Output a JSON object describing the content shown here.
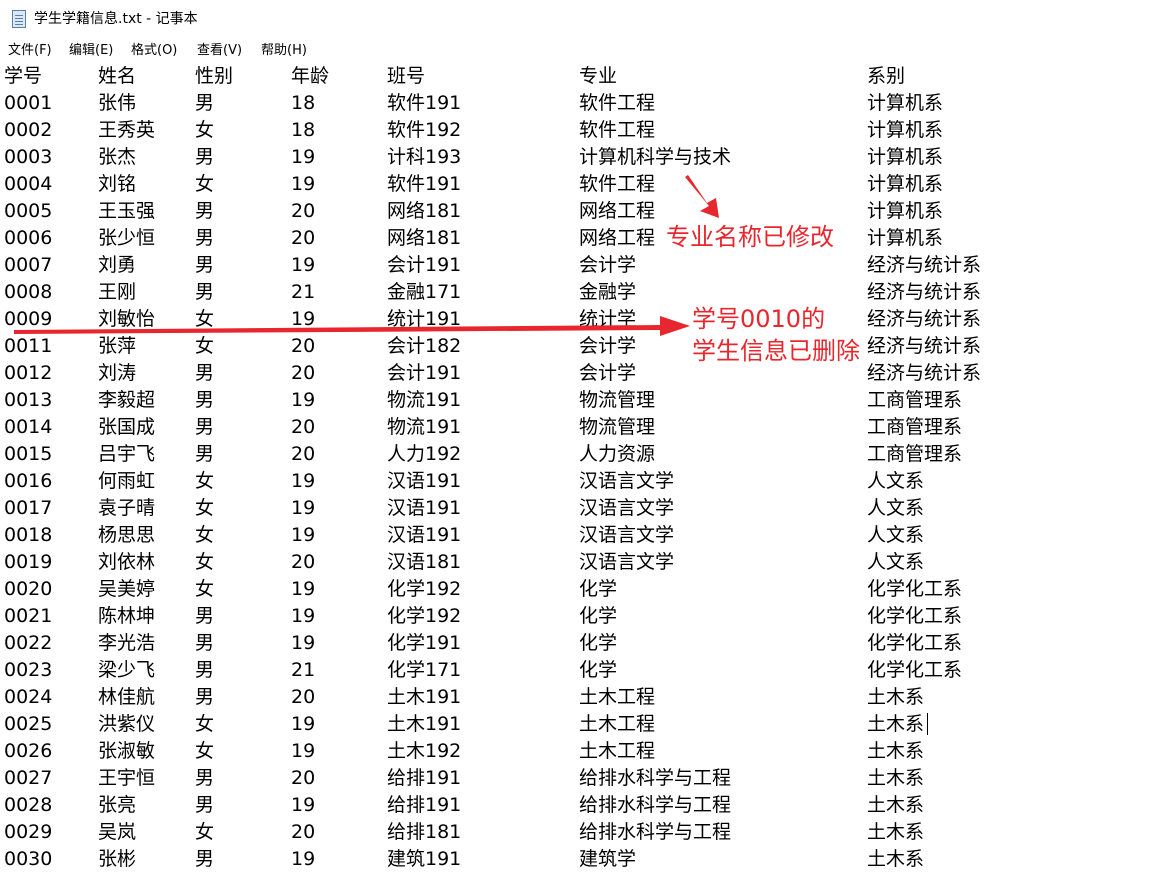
{
  "window": {
    "title": "学生学籍信息.txt - 记事本",
    "icon": "notepad-icon"
  },
  "menu": [
    "文件(F)",
    "编辑(E)",
    "格式(O)",
    "查看(V)",
    "帮助(H)"
  ],
  "table": {
    "headers": [
      "学号",
      "姓名",
      "性别",
      "年龄",
      "班号",
      "专业",
      "系别"
    ],
    "rows": [
      [
        "0001",
        "张伟",
        "男",
        "18",
        "软件191",
        "软件工程",
        "计算机系"
      ],
      [
        "0002",
        "王秀英",
        "女",
        "18",
        "软件192",
        "软件工程",
        "计算机系"
      ],
      [
        "0003",
        "张杰",
        "男",
        "19",
        "计科193",
        "计算机科学与技术",
        "计算机系"
      ],
      [
        "0004",
        "刘铭",
        "女",
        "19",
        "软件191",
        "软件工程",
        "计算机系"
      ],
      [
        "0005",
        "王玉强",
        "男",
        "20",
        "网络181",
        "网络工程",
        "计算机系"
      ],
      [
        "0006",
        "张少恒",
        "男",
        "20",
        "网络181",
        "网络工程",
        "计算机系"
      ],
      [
        "0007",
        "刘勇",
        "男",
        "19",
        "会计191",
        "会计学",
        "经济与统计系"
      ],
      [
        "0008",
        "王刚",
        "男",
        "21",
        "金融171",
        "金融学",
        "经济与统计系"
      ],
      [
        "0009",
        "刘敏怡",
        "女",
        "19",
        "统计191",
        "统计学",
        "经济与统计系"
      ],
      [
        "0011",
        "张萍",
        "女",
        "20",
        "会计182",
        "会计学",
        "经济与统计系"
      ],
      [
        "0012",
        "刘涛",
        "男",
        "20",
        "会计191",
        "会计学",
        "经济与统计系"
      ],
      [
        "0013",
        "李毅超",
        "男",
        "19",
        "物流191",
        "物流管理",
        "工商管理系"
      ],
      [
        "0014",
        "张国成",
        "男",
        "20",
        "物流191",
        "物流管理",
        "工商管理系"
      ],
      [
        "0015",
        "吕宇飞",
        "男",
        "20",
        "人力192",
        "人力资源",
        "工商管理系"
      ],
      [
        "0016",
        "何雨虹",
        "女",
        "19",
        "汉语191",
        "汉语言文学",
        "人文系"
      ],
      [
        "0017",
        "袁子晴",
        "女",
        "19",
        "汉语191",
        "汉语言文学",
        "人文系"
      ],
      [
        "0018",
        "杨思思",
        "女",
        "19",
        "汉语191",
        "汉语言文学",
        "人文系"
      ],
      [
        "0019",
        "刘依林",
        "女",
        "20",
        "汉语181",
        "汉语言文学",
        "人文系"
      ],
      [
        "0020",
        "吴美婷",
        "女",
        "19",
        "化学192",
        "化学",
        "化学化工系"
      ],
      [
        "0021",
        "陈林坤",
        "男",
        "19",
        "化学192",
        "化学",
        "化学化工系"
      ],
      [
        "0022",
        "李光浩",
        "男",
        "19",
        "化学191",
        "化学",
        "化学化工系"
      ],
      [
        "0023",
        "梁少飞",
        "男",
        "21",
        "化学171",
        "化学",
        "化学化工系"
      ],
      [
        "0024",
        "林佳航",
        "男",
        "20",
        "土木191",
        "土木工程",
        "土木系"
      ],
      [
        "0025",
        "洪紫仪",
        "女",
        "19",
        "土木191",
        "土木工程",
        "土木系"
      ],
      [
        "0026",
        "张淑敏",
        "女",
        "19",
        "土木192",
        "土木工程",
        "土木系"
      ],
      [
        "0027",
        "王宇恒",
        "男",
        "20",
        "给排191",
        "给排水科学与工程",
        "土木系"
      ],
      [
        "0028",
        "张亮",
        "男",
        "19",
        "给排191",
        "给排水科学与工程",
        "土木系"
      ],
      [
        "0029",
        "吴岚",
        "女",
        "20",
        "给排181",
        "给排水科学与工程",
        "土木系"
      ],
      [
        "0030",
        "张彬",
        "男",
        "19",
        "建筑191",
        "建筑学",
        "土木系"
      ]
    ]
  },
  "annotations": {
    "major_changed": "专业名称已修改",
    "deleted_line1": "学号0010的",
    "deleted_line2": "学生信息已删除"
  },
  "colors": {
    "annotation": "#e8262d"
  }
}
